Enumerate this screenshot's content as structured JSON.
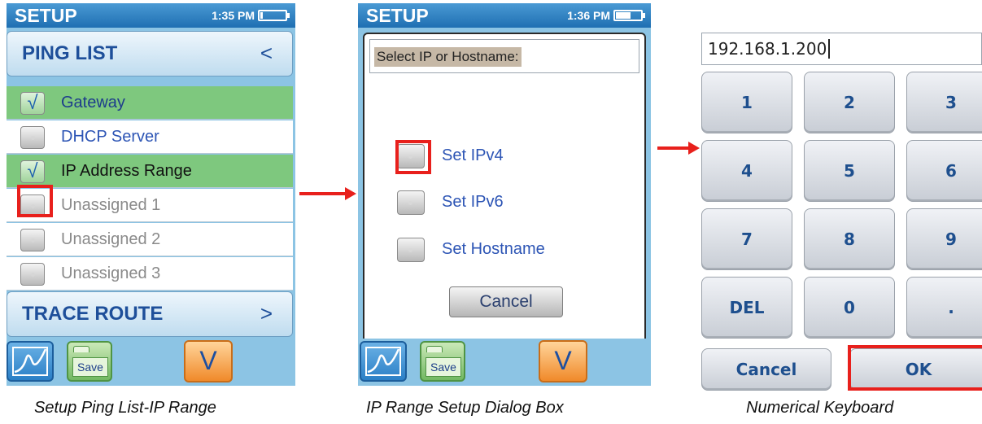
{
  "screen1": {
    "status_title": "SETUP",
    "time": "1:35 PM",
    "battery_level": 0.1,
    "ping_list_label": "PING LIST",
    "ping_list_arrow": "<",
    "items": [
      {
        "label": "Gateway",
        "checked": true
      },
      {
        "label": "DHCP Server",
        "checked": false
      },
      {
        "label": "IP Address Range",
        "checked": true
      },
      {
        "label": "Unassigned 1",
        "checked": false
      },
      {
        "label": "Unassigned 2",
        "checked": false
      },
      {
        "label": "Unassigned 3",
        "checked": false
      }
    ],
    "check_glyph": "√",
    "trace_route_label": "TRACE ROUTE",
    "trace_route_arrow": ">",
    "save_label": "Save",
    "down_glyph": "V",
    "caption": "Setup Ping List-IP Range"
  },
  "screen2": {
    "status_title": "SETUP",
    "time": "1:36 PM",
    "battery_level": 0.55,
    "prompt": "Select IP or Hostname:",
    "options": [
      "Set IPv4",
      "Set IPv6",
      "Set Hostname"
    ],
    "cancel_label": "Cancel",
    "save_label": "Save",
    "down_glyph": "V",
    "caption": "IP Range Setup Dialog Box"
  },
  "screen3": {
    "ip_value": "192.168.1.200",
    "keys": [
      "1",
      "2",
      "3",
      "4",
      "5",
      "6",
      "7",
      "8",
      "9",
      "DEL",
      "0",
      "."
    ],
    "cancel_label": "Cancel",
    "ok_label": "OK",
    "caption": "Numerical Keyboard"
  },
  "colors": {
    "highlight": "#e8201c",
    "checked_row": "#7ec87e",
    "title_blue": "#1e4f9a"
  },
  "icons": [
    "check-icon",
    "graph-icon",
    "folder-save-icon",
    "chevron-down-icon",
    "battery-icon",
    "arrow-right-icon"
  ]
}
